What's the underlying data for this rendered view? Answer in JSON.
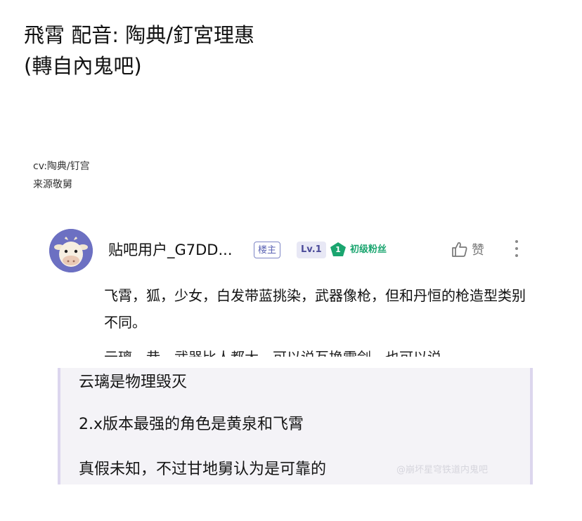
{
  "post": {
    "title_line1": "飛霄 配音: 陶典/釘宮理惠",
    "title_line2": "(轉自內鬼吧)"
  },
  "caption": {
    "line1": "cv:陶典/钉宫",
    "line2": "来源敬舅"
  },
  "comment": {
    "username": "贴吧用户_G7DD...",
    "badge_owner": "楼主",
    "badge_level": "Lv.1",
    "badge_fan_level": "1",
    "badge_fan": "初级粉丝",
    "like_label": "赞",
    "body": "飞霄，狐，少女，白发带蓝挑染，武器像枪，但和丹恒的枪造型类别不同。",
    "cut_line": "云璃，巷，武器比人都大，可以说互换雪剑，也可以说"
  },
  "panel": {
    "line1": "云璃是物理毁灭",
    "line2": "2.x版本最强的角色是黄泉和飞霄",
    "line3": "真假未知，不过甘地舅认为是可靠的",
    "watermark": "@崩坏星穹铁道内鬼吧"
  },
  "colors": {
    "accent": "#5c64b4",
    "fan_green": "#1aa56f",
    "panel_bg": "#f4f3f7"
  }
}
